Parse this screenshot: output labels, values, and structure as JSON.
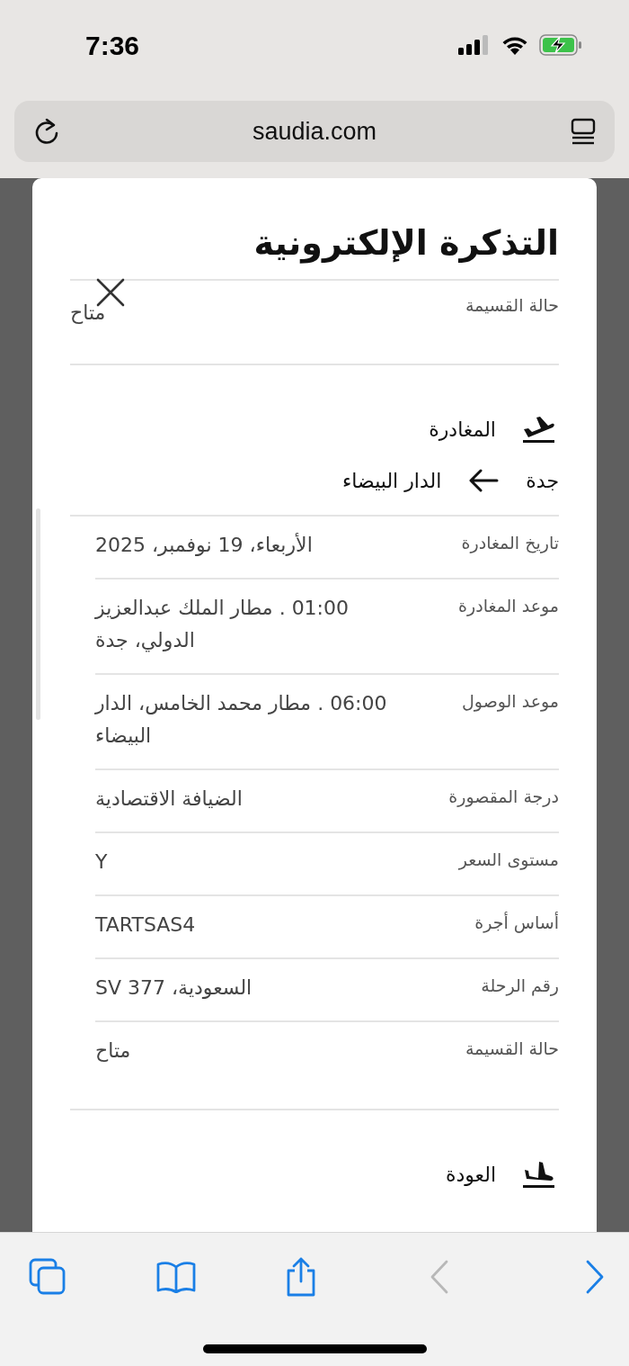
{
  "status_bar": {
    "time": "7:36"
  },
  "browser": {
    "url": "saudia.com"
  },
  "modal": {
    "title": "التذكرة الإلكترونية",
    "top_row": {
      "label": "حالة القسيمة",
      "value": "متاح"
    },
    "sections": [
      {
        "kind": "departure",
        "heading": "المغادرة",
        "from": "جدة",
        "to": "الدار البيضاء",
        "rows": [
          {
            "label": "تاريخ المغادرة",
            "value": "الأربعاء، 19 نوفمبر، 2025"
          },
          {
            "label": "موعد المغادرة",
            "value": "01:00 . مطار الملك عبدالعزيز الدولي، جدة"
          },
          {
            "label": "موعد الوصول",
            "value": "06:00 . مطار محمد الخامس، الدار البيضاء"
          },
          {
            "label": "درجة المقصورة",
            "value": "الضيافة الاقتصادية"
          },
          {
            "label": "مستوى السعر",
            "value": "Y"
          },
          {
            "label": "أساس أجرة",
            "value": "TARTSAS4"
          },
          {
            "label": "رقم الرحلة",
            "value": "السعودية، SV 377"
          },
          {
            "label": "حالة القسيمة",
            "value": "متاح"
          }
        ]
      },
      {
        "kind": "return",
        "heading": "العودة"
      }
    ]
  },
  "toolbar": {
    "back_disabled": true,
    "forward_disabled": false
  }
}
